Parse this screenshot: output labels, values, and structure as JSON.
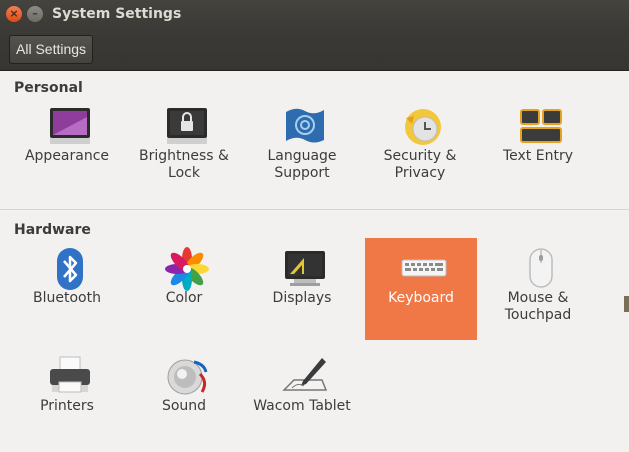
{
  "window": {
    "title": "System Settings"
  },
  "toolbar": {
    "all_settings_label": "All Settings"
  },
  "sections": {
    "personal": {
      "title": "Personal",
      "items": [
        {
          "label": "Appearance",
          "icon": "appearance-icon"
        },
        {
          "label": "Brightness &\nLock",
          "icon": "lock-icon"
        },
        {
          "label": "Language\nSupport",
          "icon": "language-flag-icon"
        },
        {
          "label": "Security &\nPrivacy",
          "icon": "security-clock-icon"
        },
        {
          "label": "Text Entry",
          "icon": "keys-icon"
        }
      ]
    },
    "hardware": {
      "title": "Hardware",
      "items": [
        {
          "label": "Bluetooth",
          "icon": "bluetooth-icon"
        },
        {
          "label": "Color",
          "icon": "color-flower-icon"
        },
        {
          "label": "Displays",
          "icon": "display-icon"
        },
        {
          "label": "Keyboard",
          "icon": "keyboard-icon",
          "selected": true
        },
        {
          "label": "Mouse &\nTouchpad",
          "icon": "mouse-icon"
        },
        {
          "label": "Printers",
          "icon": "printer-icon"
        },
        {
          "label": "Sound",
          "icon": "speaker-icon"
        },
        {
          "label": "Wacom Tablet",
          "icon": "tablet-pen-icon"
        }
      ]
    }
  },
  "colors": {
    "selection": "#f07746",
    "titlebar": "#3c3b37",
    "background": "#f2f1f0"
  }
}
